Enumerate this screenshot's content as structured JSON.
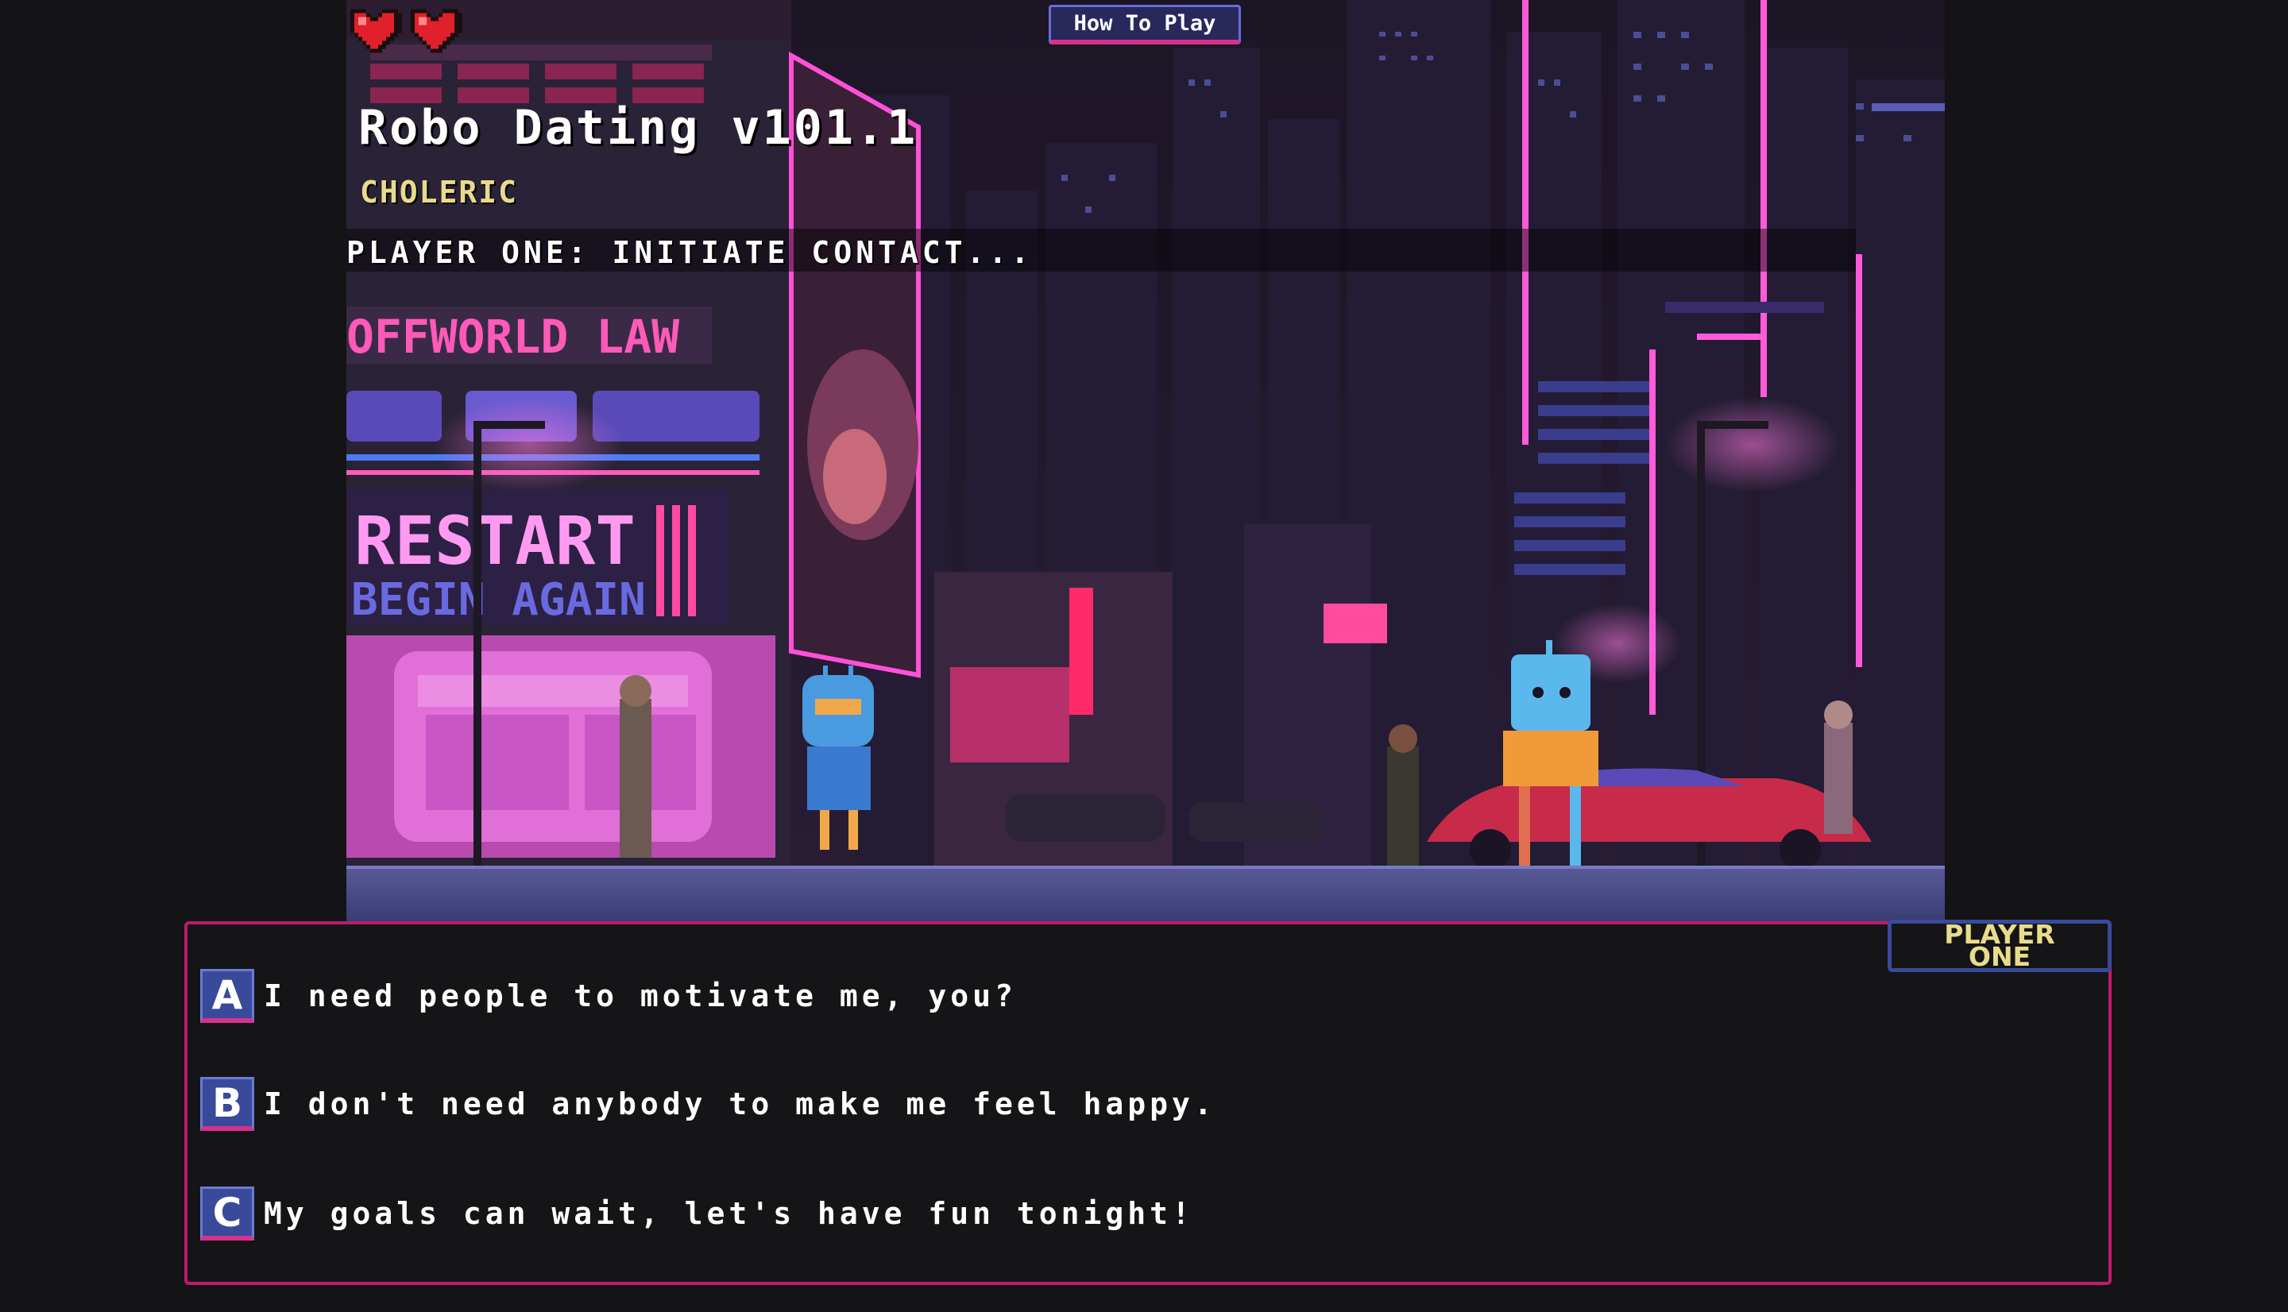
{
  "hud": {
    "hearts": 2,
    "how_to_play": "How To Play"
  },
  "game": {
    "title": "Robo Dating v101.1",
    "personality": "CHOLERIC",
    "status": "PLAYER ONE: INITIATE CONTACT..."
  },
  "scene": {
    "signs": {
      "offworld": "OFFWORLD LAW",
      "restart": "RESTART",
      "begin": "BEGIN AGAIN"
    }
  },
  "dialog": {
    "speaker": "PLAYER ONE",
    "choices": [
      {
        "key": "A",
        "text": "I need people to motivate me, you?"
      },
      {
        "key": "B",
        "text": "I don't need anybody to make me feel happy."
      },
      {
        "key": "C",
        "text": "My goals can wait, let's have fun tonight!"
      }
    ]
  },
  "colors": {
    "accent": "#c01a6a",
    "badge": "#3a4a9a",
    "title_yellow": "#e8dc8c",
    "neon_pink": "#ff3cc8"
  }
}
